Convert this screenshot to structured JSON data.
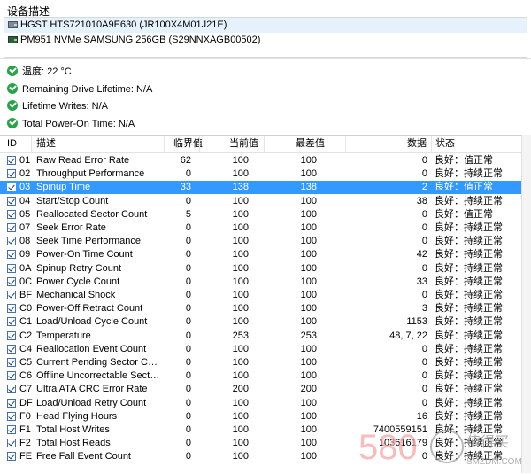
{
  "section_title": "设备描述",
  "devices": [
    {
      "label": "HGST HTS721010A9E630 (JR100X4M01J21E)",
      "icon": "drive-icon",
      "selected": true
    },
    {
      "label": "PM951 NVMe SAMSUNG 256GB (S29NNXAGB00502)",
      "icon": "nvme-drive-icon",
      "selected": false
    }
  ],
  "info": [
    {
      "icon": "ok-check-icon",
      "text": "温度: 22 °C"
    },
    {
      "icon": "ok-check-icon",
      "text": "Remaining Drive Lifetime: N/A"
    },
    {
      "icon": "ok-check-icon",
      "text": "Lifetime Writes: N/A"
    },
    {
      "icon": "ok-check-icon",
      "text": "Total Power-On Time: N/A"
    }
  ],
  "columns": {
    "id": "ID",
    "desc": "描述",
    "threshold": "临界值",
    "current": "当前值",
    "worst": "最差值",
    "data": "数据",
    "status": "状态"
  },
  "rows": [
    {
      "id": "01",
      "desc": "Raw Read Error Rate",
      "threshold": "62",
      "current": "100",
      "worst": "100",
      "data": "0",
      "status": "良好：值正常"
    },
    {
      "id": "02",
      "desc": "Throughput Performance",
      "threshold": "0",
      "current": "100",
      "worst": "100",
      "data": "0",
      "status": "良好：持续正常"
    },
    {
      "id": "03",
      "desc": "Spinup Time",
      "threshold": "33",
      "current": "138",
      "worst": "138",
      "data": "2",
      "status": "良好：值正常",
      "selected": true
    },
    {
      "id": "04",
      "desc": "Start/Stop Count",
      "threshold": "0",
      "current": "100",
      "worst": "100",
      "data": "38",
      "status": "良好：持续正常"
    },
    {
      "id": "05",
      "desc": "Reallocated Sector Count",
      "threshold": "5",
      "current": "100",
      "worst": "100",
      "data": "0",
      "status": "良好：值正常"
    },
    {
      "id": "07",
      "desc": "Seek Error Rate",
      "threshold": "0",
      "current": "100",
      "worst": "100",
      "data": "0",
      "status": "良好：持续正常"
    },
    {
      "id": "08",
      "desc": "Seek Time Performance",
      "threshold": "0",
      "current": "100",
      "worst": "100",
      "data": "0",
      "status": "良好：持续正常"
    },
    {
      "id": "09",
      "desc": "Power-On Time Count",
      "threshold": "0",
      "current": "100",
      "worst": "100",
      "data": "42",
      "status": "良好：持续正常"
    },
    {
      "id": "0A",
      "desc": "Spinup Retry Count",
      "threshold": "0",
      "current": "100",
      "worst": "100",
      "data": "0",
      "status": "良好：持续正常"
    },
    {
      "id": "0C",
      "desc": "Power Cycle Count",
      "threshold": "0",
      "current": "100",
      "worst": "100",
      "data": "33",
      "status": "良好：持续正常"
    },
    {
      "id": "BF",
      "desc": "Mechanical Shock",
      "threshold": "0",
      "current": "100",
      "worst": "100",
      "data": "0",
      "status": "良好：持续正常"
    },
    {
      "id": "C0",
      "desc": "Power-Off Retract Count",
      "threshold": "0",
      "current": "100",
      "worst": "100",
      "data": "3",
      "status": "良好：持续正常"
    },
    {
      "id": "C1",
      "desc": "Load/Unload Cycle Count",
      "threshold": "0",
      "current": "100",
      "worst": "100",
      "data": "1153",
      "status": "良好：持续正常"
    },
    {
      "id": "C2",
      "desc": "Temperature",
      "threshold": "0",
      "current": "253",
      "worst": "253",
      "data": "48, 7, 22",
      "status": "良好：持续正常"
    },
    {
      "id": "C4",
      "desc": "Reallocation Event Count",
      "threshold": "0",
      "current": "100",
      "worst": "100",
      "data": "0",
      "status": "良好：持续正常"
    },
    {
      "id": "C5",
      "desc": "Current Pending Sector Count",
      "threshold": "0",
      "current": "100",
      "worst": "100",
      "data": "0",
      "status": "良好：持续正常"
    },
    {
      "id": "C6",
      "desc": "Offline Uncorrectable Sector C...",
      "threshold": "0",
      "current": "100",
      "worst": "100",
      "data": "0",
      "status": "良好：持续正常"
    },
    {
      "id": "C7",
      "desc": "Ultra ATA CRC Error Rate",
      "threshold": "0",
      "current": "200",
      "worst": "200",
      "data": "0",
      "status": "良好：持续正常"
    },
    {
      "id": "DF",
      "desc": "Load/Unload Retry Count",
      "threshold": "0",
      "current": "100",
      "worst": "100",
      "data": "0",
      "status": "良好：持续正常"
    },
    {
      "id": "F0",
      "desc": "Head Flying Hours",
      "threshold": "0",
      "current": "100",
      "worst": "100",
      "data": "16",
      "status": "良好：持续正常"
    },
    {
      "id": "F1",
      "desc": "Total Host Writes",
      "threshold": "0",
      "current": "100",
      "worst": "100",
      "data": "7400559151",
      "status": "良好：持续正常"
    },
    {
      "id": "F2",
      "desc": "Total Host Reads",
      "threshold": "0",
      "current": "100",
      "worst": "100",
      "data": "103616179",
      "status": "良好：持续正常"
    },
    {
      "id": "FE",
      "desc": "Free Fall Event Count",
      "threshold": "0",
      "current": "100",
      "worst": "100",
      "data": "0",
      "status": "良好：持续正常"
    }
  ],
  "watermark": {
    "number": "580",
    "site": "SMZDM.COM",
    "brand": "值得买"
  }
}
